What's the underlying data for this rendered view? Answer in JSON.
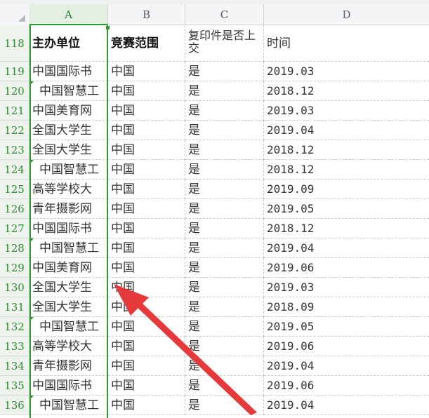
{
  "columns": [
    "A",
    "B",
    "C",
    "D"
  ],
  "header_row": {
    "row_number": "118",
    "cells": [
      "主办单位",
      "竞赛范围",
      "复印件是否上交",
      "时间"
    ]
  },
  "rows": [
    {
      "n": "119",
      "a": "中国国际书",
      "b": "中国",
      "c": "是",
      "d": "2019.03",
      "indent": false
    },
    {
      "n": "120",
      "a": "中国智慧工",
      "b": "中国",
      "c": "是",
      "d": "2018.12",
      "indent": true
    },
    {
      "n": "121",
      "a": "中国美育网",
      "b": "中国",
      "c": "是",
      "d": "2019.03",
      "indent": false
    },
    {
      "n": "122",
      "a": "全国大学生",
      "b": "中国",
      "c": "是",
      "d": "2019.04",
      "indent": false
    },
    {
      "n": "123",
      "a": "全国大学生",
      "b": "中国",
      "c": "是",
      "d": "2018.12",
      "indent": false
    },
    {
      "n": "124",
      "a": "中国智慧工",
      "b": "中国",
      "c": "是",
      "d": "2018.12",
      "indent": true
    },
    {
      "n": "125",
      "a": "高等学校大",
      "b": "中国",
      "c": "是",
      "d": "2019.09",
      "indent": false
    },
    {
      "n": "126",
      "a": "青年摄影网",
      "b": "中国",
      "c": "是",
      "d": "2019.05",
      "indent": false
    },
    {
      "n": "127",
      "a": "中国国际书",
      "b": "中国",
      "c": "是",
      "d": "2018.12",
      "indent": false
    },
    {
      "n": "128",
      "a": "中国智慧工",
      "b": "中国",
      "c": "是",
      "d": "2019.04",
      "indent": true
    },
    {
      "n": "129",
      "a": "中国美育网",
      "b": "中国",
      "c": "是",
      "d": "2019.06",
      "indent": false
    },
    {
      "n": "130",
      "a": "全国大学生",
      "b": "中国",
      "c": "是",
      "d": "2019.03",
      "indent": false
    },
    {
      "n": "131",
      "a": "全国大学生",
      "b": "中国",
      "c": "是",
      "d": "2018.09",
      "indent": false
    },
    {
      "n": "132",
      "a": "中国智慧工",
      "b": "中国",
      "c": "是",
      "d": "2019.05",
      "indent": true
    },
    {
      "n": "133",
      "a": "高等学校大",
      "b": "中国",
      "c": "是",
      "d": "2019.06",
      "indent": false
    },
    {
      "n": "134",
      "a": "青年摄影网",
      "b": "中国",
      "c": "是",
      "d": "2019.04",
      "indent": false
    },
    {
      "n": "135",
      "a": "中国国际书",
      "b": "中国",
      "c": "是",
      "d": "2019.06",
      "indent": false
    },
    {
      "n": "136",
      "a": "中国智慧工",
      "b": "中国",
      "c": "是",
      "d": "2019.04",
      "indent": true
    }
  ],
  "colors": {
    "selection_green": "#2f9a2f",
    "annotation_arrow": "#e5393b"
  }
}
